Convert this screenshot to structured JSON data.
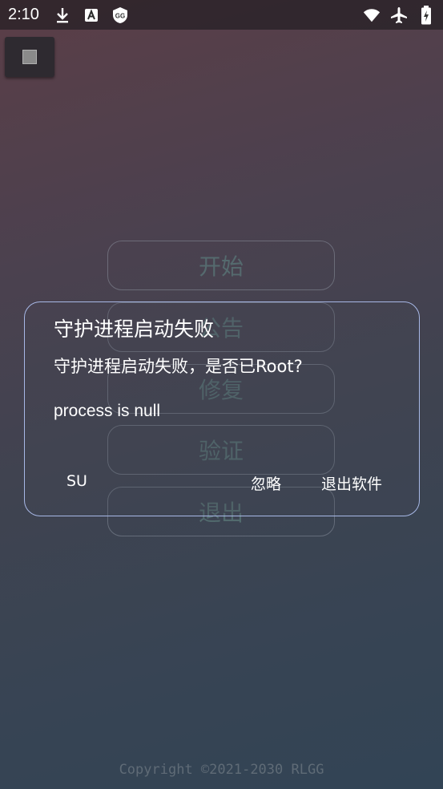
{
  "status_bar": {
    "time": "2:10",
    "left_icons": [
      "download-icon",
      "font-a-icon",
      "gg-shield-icon"
    ],
    "right_icons": [
      "wifi-icon",
      "airplane-mode-icon",
      "battery-charging-icon"
    ]
  },
  "menu": {
    "items": [
      {
        "label": "开始"
      },
      {
        "label": "公告"
      },
      {
        "label": "修复"
      },
      {
        "label": "验证"
      },
      {
        "label": "退出"
      }
    ]
  },
  "dialog": {
    "title": "守护进程启动失败",
    "message": "守护进程启动失败，是否已Root?",
    "detail": "process is null",
    "buttons": {
      "su": "SU",
      "ignore": "忽略",
      "exit": "退出软件"
    },
    "border_color": "#a7b8e6"
  },
  "footer": {
    "copyright": "Copyright ©2021-2030 RLGG"
  }
}
